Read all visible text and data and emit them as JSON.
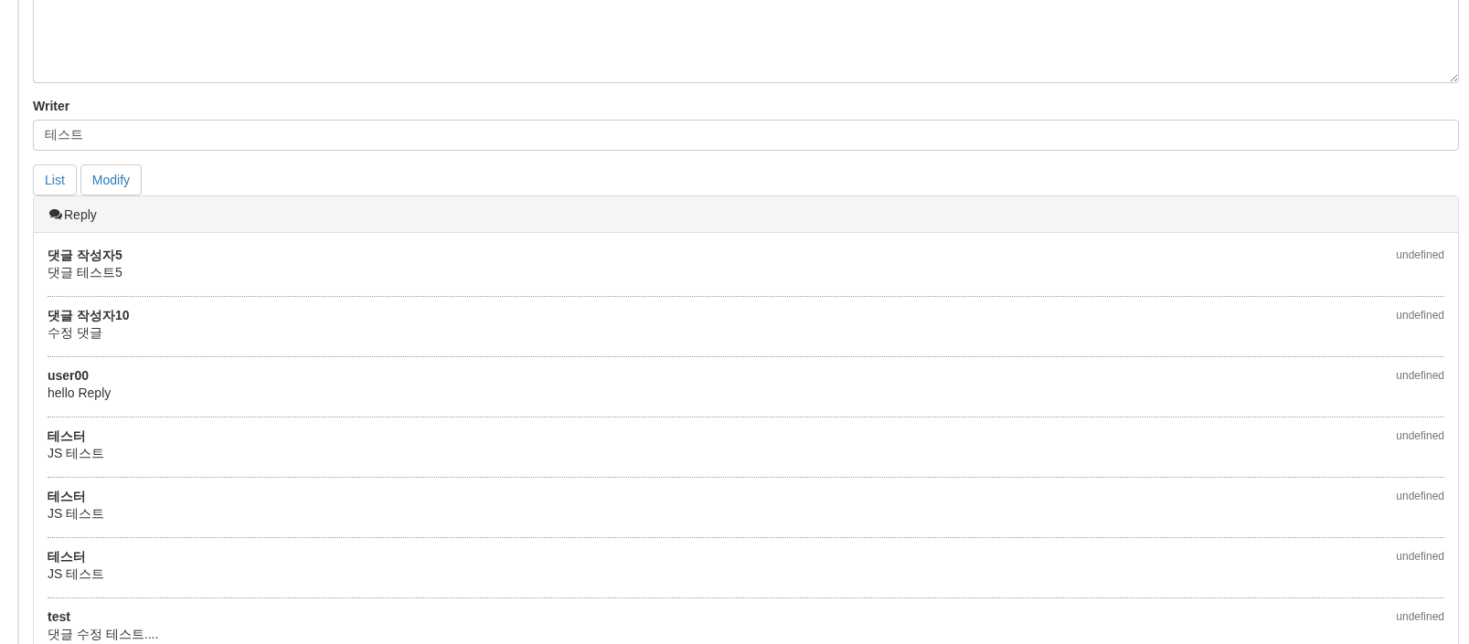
{
  "form": {
    "writer": {
      "label": "Writer",
      "value": "테스트"
    }
  },
  "buttons": [
    {
      "label": "List"
    },
    {
      "label": "Modify"
    }
  ],
  "reply_panel": {
    "title": "Reply",
    "replies": [
      {
        "replyer": "댓글 작성자5",
        "text": "댓글 테스트5",
        "date": "undefined"
      },
      {
        "replyer": "댓글 작성자10",
        "text": "수정 댓글",
        "date": "undefined"
      },
      {
        "replyer": "user00",
        "text": "hello Reply",
        "date": "undefined"
      },
      {
        "replyer": "테스터",
        "text": "JS 테스트",
        "date": "undefined"
      },
      {
        "replyer": "테스터",
        "text": "JS 테스트",
        "date": "undefined"
      },
      {
        "replyer": "테스터",
        "text": "JS 테스트",
        "date": "undefined"
      },
      {
        "replyer": "test",
        "text": "댓글 수정 테스트....",
        "date": "undefined"
      }
    ]
  }
}
